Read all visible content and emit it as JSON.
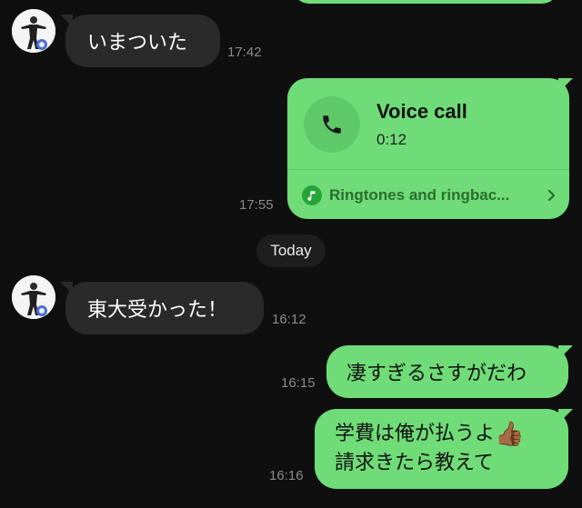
{
  "colors": {
    "background": "#0f0f0f",
    "incoming_bubble": "#2a2a2a",
    "outgoing_bubble": "#6fdc77",
    "timestamp": "#8a8a8a"
  },
  "messages": [
    {
      "direction": "in",
      "text": "いまついた",
      "time": "17:42"
    },
    {
      "direction": "out",
      "type": "voice_call",
      "title": "Voice call",
      "duration": "0:12",
      "footer": "Ringtones and ringbac...",
      "time": "17:55"
    },
    {
      "direction": "in",
      "text": "東大受かった！",
      "time": "16:12"
    },
    {
      "direction": "out",
      "text": "凄すぎるさすがだわ",
      "time": "16:15"
    },
    {
      "direction": "out",
      "lines": [
        "学費は俺が払うよ",
        "請求きたら教えて"
      ],
      "emoji": "👍🏾",
      "time": "16:16"
    }
  ],
  "date_divider": "Today",
  "icons": {
    "avatar": "avatar-icon",
    "phone": "phone-icon",
    "music": "music-note-icon",
    "chevron": "chevron-right-icon"
  }
}
